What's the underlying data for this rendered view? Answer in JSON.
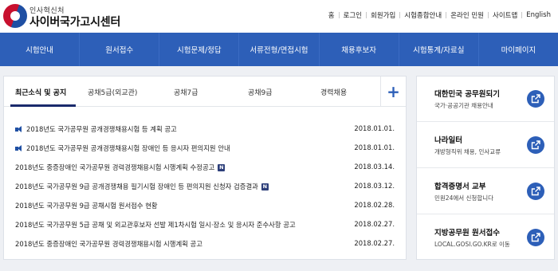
{
  "header": {
    "org_small": "인사혁신처",
    "org_name": "사이버국가고시센터",
    "util_links": [
      "홈",
      "로그인",
      "회원가입",
      "시험종합안내",
      "온라인 민원",
      "사이트맵",
      "English"
    ]
  },
  "nav": {
    "items": [
      "시험안내",
      "원서접수",
      "시험문제/정답",
      "서류전형/면접시험",
      "채용후보자",
      "시험통계/자료실",
      "마이페이지"
    ]
  },
  "news": {
    "tabs": [
      "최근소식 및 공지",
      "공채5급(외교관)",
      "공채7급",
      "공채9급",
      "경력채용"
    ],
    "plus_label": "+",
    "new_badge": "N",
    "rows": [
      {
        "title": "2018년도 국가공무원 공개경쟁채용시험 등 계획 공고",
        "date": "2018.01.01."
      },
      {
        "title": "2018년도 국가공무원 공개경쟁채용시험 장애인 등 응시자 편의지원 안내",
        "date": "2018.01.01."
      },
      {
        "title": "2018년도 중증장애인 국가공무원 경력경쟁채용시험 시행계획 수정공고",
        "date": "2018.03.14."
      },
      {
        "title": "2018년도 국가공무원 9급 공개경쟁채용 필기시험 장애인 등 편의지원 신청자 검증결과",
        "date": "2018.03.12."
      },
      {
        "title": "2018년도 국가공무원 9급 공채시험 원서접수 현황",
        "date": "2018.02.28."
      },
      {
        "title": "2018년도 국가공무원 5급 공채 및 외교관후보자 선발 제1차시험 일시·장소 및 응시자 준수사항 공고",
        "date": "2018.02.27."
      },
      {
        "title": "2018년도 중증장애인 국가공무원 경력경쟁채용시험 시행계획 공고",
        "date": "2018.02.27."
      }
    ]
  },
  "side": {
    "cards": [
      {
        "title": "대한민국 공무원되기",
        "sub": "국가·공공기관 채용안내"
      },
      {
        "title": "나라일터",
        "sub": "개방형직위 채용, 인사교류"
      },
      {
        "title": "합격증명서 교부",
        "sub": "민원24에서 신청합니다"
      },
      {
        "title": "지방공무원 원서접수",
        "sub": "LOCAL.GOSI.GO.KR로 이동"
      }
    ]
  },
  "colors": {
    "nav_bg": "#2d5fb8",
    "accent": "#1f4fa3",
    "badge": "#2d3f7a"
  }
}
